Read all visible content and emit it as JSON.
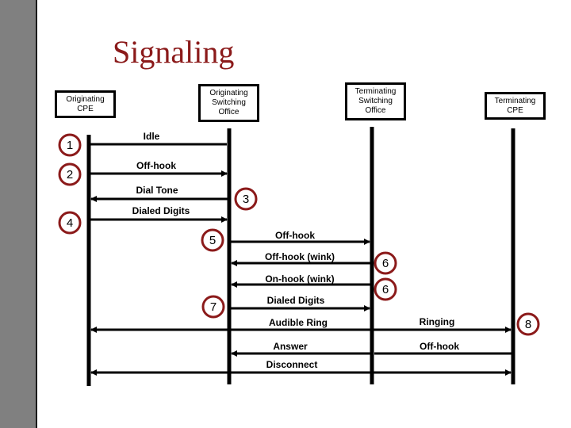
{
  "title": "Signaling",
  "colors": {
    "title": "#8b1a1a",
    "step_circle": "#8b1a1a",
    "sidebar": "#808080",
    "line": "#000000"
  },
  "entities": [
    {
      "id": "orig-cpe",
      "label": "Originating\nCPE"
    },
    {
      "id": "orig-so",
      "label": "Originating\nSwitching\nOffice"
    },
    {
      "id": "term-so",
      "label": "Terminating\nSwitching\nOffice"
    },
    {
      "id": "term-cpe",
      "label": "Terminating\nCPE"
    }
  ],
  "messages": [
    {
      "label": "Idle",
      "from": "orig-cpe",
      "to": "orig-so",
      "arrow": "none"
    },
    {
      "label": "Off-hook",
      "from": "orig-cpe",
      "to": "orig-so",
      "arrow": "forward"
    },
    {
      "label": "Dial Tone",
      "from": "orig-so",
      "to": "orig-cpe",
      "arrow": "forward"
    },
    {
      "label": "Dialed Digits",
      "from": "orig-cpe",
      "to": "orig-so",
      "arrow": "forward"
    },
    {
      "label": "Off-hook",
      "from": "orig-so",
      "to": "term-so",
      "arrow": "forward"
    },
    {
      "label": "Off-hook (wink)",
      "from": "term-so",
      "to": "orig-so",
      "arrow": "forward"
    },
    {
      "label": "On-hook  (wink)",
      "from": "term-so",
      "to": "orig-so",
      "arrow": "forward"
    },
    {
      "label": "Dialed Digits",
      "from": "orig-so",
      "to": "term-so",
      "arrow": "forward"
    },
    {
      "label": "Audible Ring",
      "from": "term-so",
      "to": "orig-cpe",
      "arrow": "forward"
    },
    {
      "label": "Ringing",
      "from": "term-so",
      "to": "term-cpe",
      "arrow": "forward"
    },
    {
      "label": "Answer",
      "from": "term-so",
      "to": "orig-so",
      "arrow": "forward"
    },
    {
      "label": "Off-hook",
      "from": "term-cpe",
      "to": "term-so",
      "arrow": "none"
    },
    {
      "label": "Disconnect",
      "from": "term-so",
      "to": "orig-cpe",
      "arrow": "forward"
    },
    {
      "label": "",
      "from": "term-so",
      "to": "term-cpe",
      "arrow": "forward"
    }
  ],
  "steps": [
    "1",
    "2",
    "3",
    "4",
    "5",
    "6",
    "6",
    "7",
    "8"
  ]
}
